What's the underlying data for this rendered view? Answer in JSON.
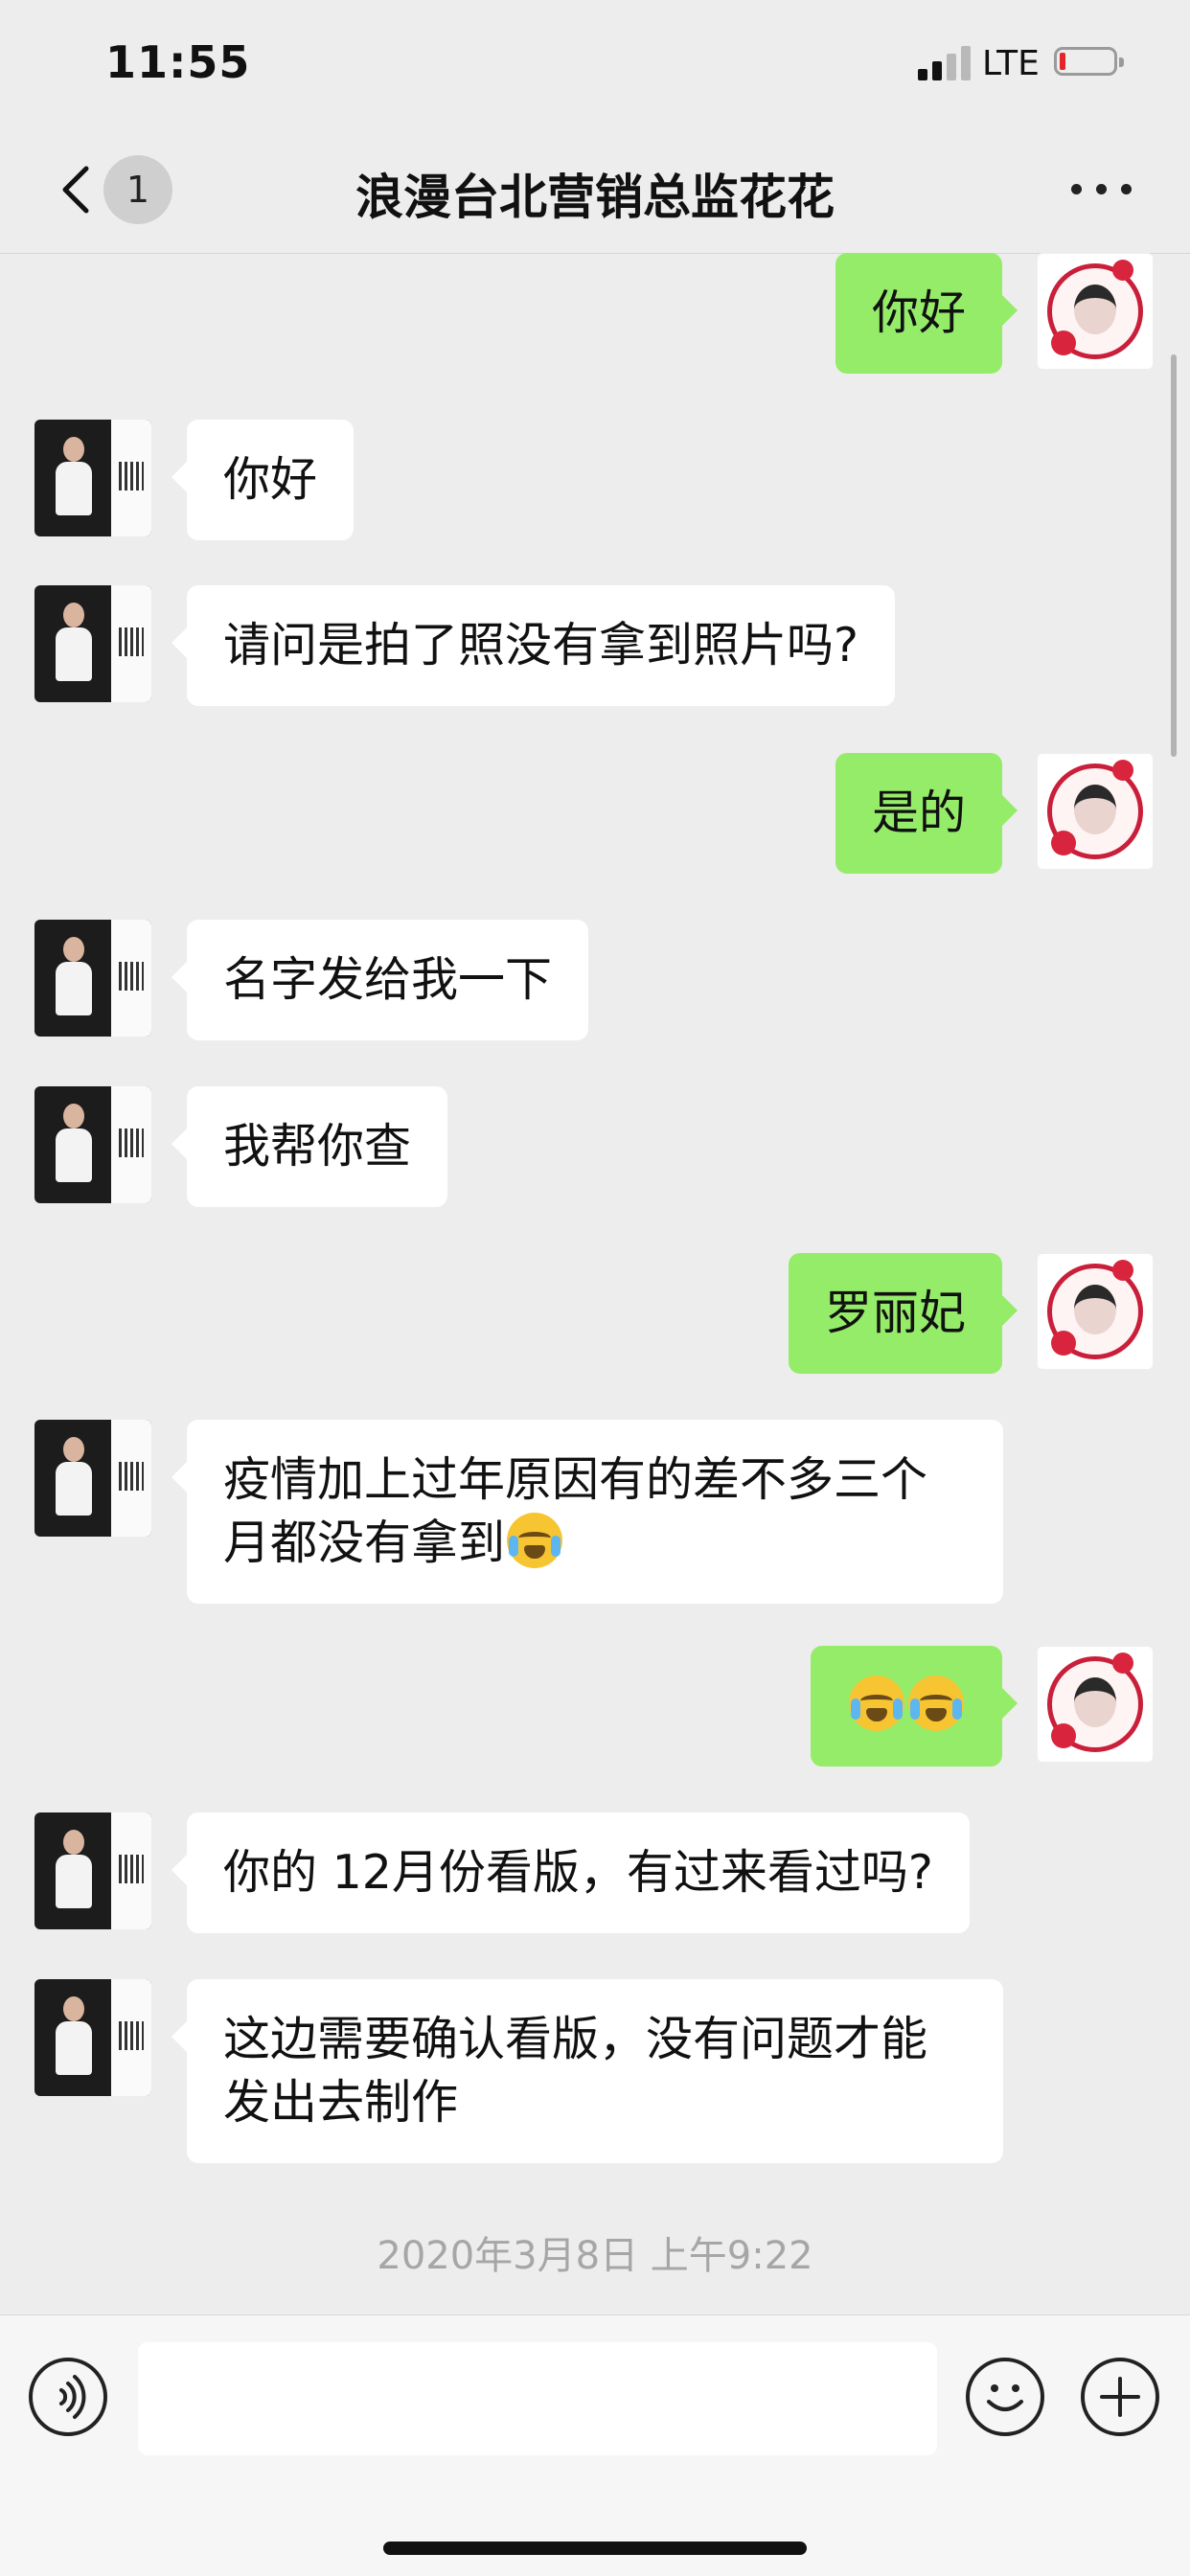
{
  "status_bar": {
    "time": "11:55",
    "network": "LTE",
    "battery_color": "#e4252b"
  },
  "nav": {
    "unread_count": "1",
    "title": "浪漫台北营销总监花花"
  },
  "messages": [
    {
      "from": "me",
      "text": "你好"
    },
    {
      "from": "other",
      "text": "你好"
    },
    {
      "from": "other",
      "text": "请问是拍了照没有拿到照片吗?"
    },
    {
      "from": "me",
      "text": "是的"
    },
    {
      "from": "other",
      "text": "名字发给我一下"
    },
    {
      "from": "other",
      "text": "我帮你查"
    },
    {
      "from": "me",
      "text": "罗丽妃"
    },
    {
      "from": "other",
      "text": "疫情加上过年原因有的差不多三个月都没有拿到",
      "emoji": "loudly-crying-face"
    },
    {
      "from": "me",
      "text": "",
      "emoji": "loudly-crying-face x2"
    },
    {
      "from": "other",
      "text": "你的 12月份看版，有过来看过吗?"
    },
    {
      "from": "other",
      "text": "这边需要确认看版，没有问题才能发出去制作"
    }
  ],
  "timestamp": "2020年3月8日 上午9:22",
  "input": {
    "value": "",
    "placeholder": ""
  },
  "colors": {
    "my_bubble": "#95ec69",
    "other_bubble": "#ffffff",
    "background": "#ededed"
  }
}
